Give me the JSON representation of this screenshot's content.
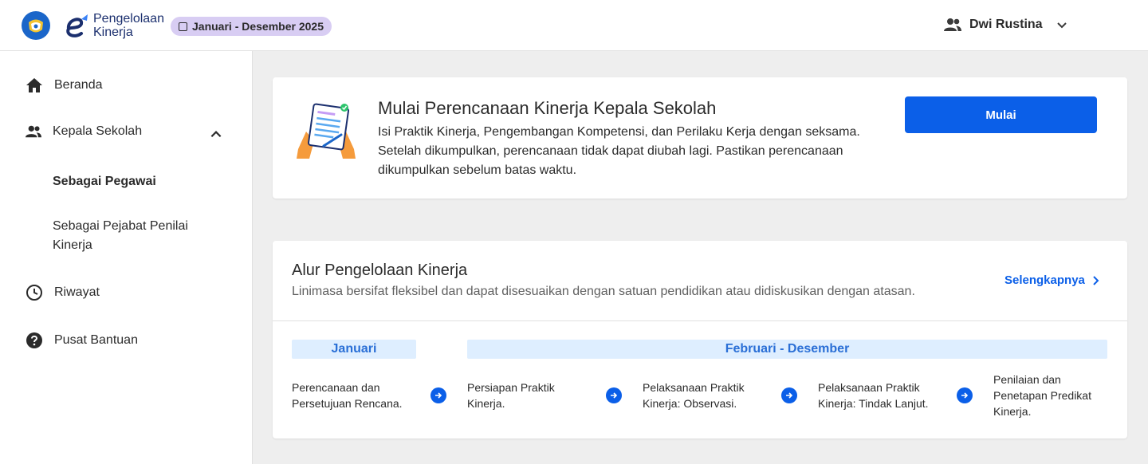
{
  "header": {
    "brand_line1": "Pengelolaan",
    "brand_line2": "Kinerja",
    "period": "Januari - Desember 2025",
    "user_name": "Dwi Rustina"
  },
  "sidebar": {
    "items": [
      {
        "label": "Beranda",
        "icon": "home-icon"
      },
      {
        "label": "Kepala Sekolah",
        "icon": "people-icon"
      },
      {
        "label": "Riwayat",
        "icon": "clock-icon"
      },
      {
        "label": "Pusat Bantuan",
        "icon": "help-icon"
      }
    ],
    "sub_items": [
      {
        "label": "Sebagai Pegawai",
        "active": true
      },
      {
        "label": "Sebagai Pejabat Penilai Kinerja",
        "active": false
      }
    ]
  },
  "start_card": {
    "title": "Mulai Perencanaan Kinerja Kepala Sekolah",
    "description": "Isi Praktik Kinerja, Pengembangan Kompetensi, dan Perilaku Kerja dengan seksama. Setelah dikumpulkan, perencanaan tidak dapat diubah lagi. Pastikan perencanaan dikumpulkan sebelum batas waktu.",
    "button_label": "Mulai"
  },
  "flow_card": {
    "title": "Alur Pengelolaan Kinerja",
    "subtitle": "Linimasa bersifat fleksibel dan dapat disesuaikan dengan satuan pendidikan atau didiskusikan dengan atasan.",
    "more_label": "Selengkapnya",
    "phases": [
      "Januari",
      "Februari - Desember"
    ],
    "steps": [
      "Perencanaan dan Persetujuan Rencana.",
      "Persiapan Praktik Kinerja.",
      "Pelaksanaan Praktik Kinerja: Observasi.",
      "Pelaksanaan Praktik Kinerja: Tindak Lanjut.",
      "Penilaian dan Penetapan Predikat Kinerja."
    ]
  },
  "colors": {
    "primary": "#0b5fe8",
    "badge_bg": "#d8cdf3",
    "phase_bg": "#deeeff",
    "phase_text": "#2a6fd6"
  }
}
